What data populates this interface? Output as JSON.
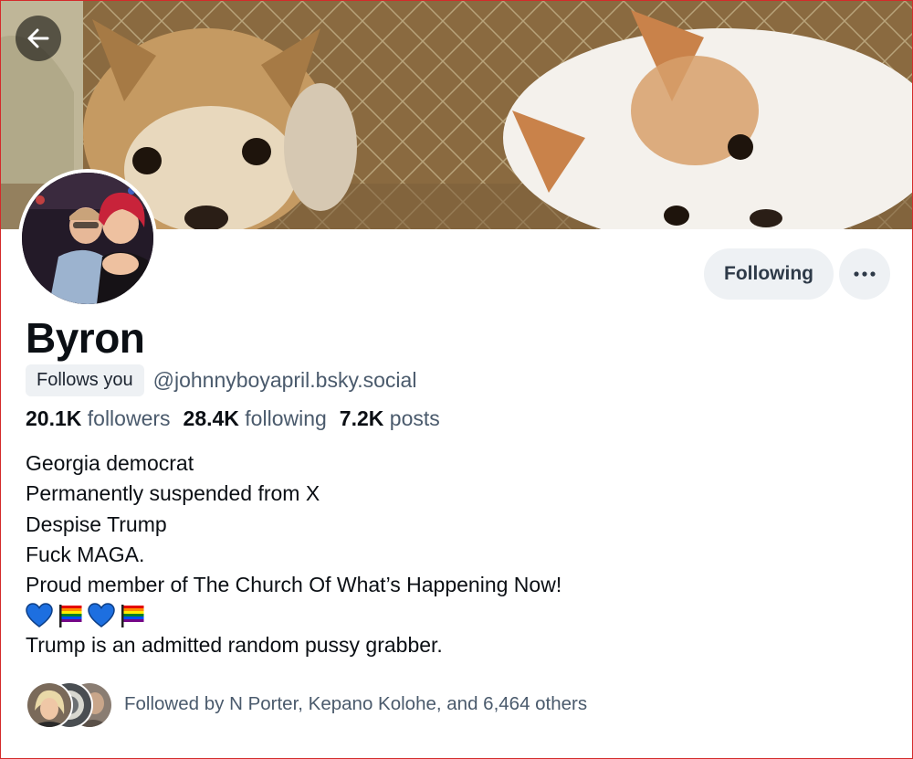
{
  "header": {
    "back_icon": "arrow-left-icon"
  },
  "profile": {
    "display_name": "Byron",
    "follows_you_badge": "Follows you",
    "handle": "@johnnyboyapril.bsky.social",
    "stats": {
      "followers_count": "20.1K",
      "followers_label": "followers",
      "following_count": "28.4K",
      "following_label": "following",
      "posts_count": "7.2K",
      "posts_label": "posts"
    },
    "bio_lines": [
      "Georgia democrat",
      "Permanently suspended from X",
      "Despise Trump",
      "Fuck MAGA.",
      "Proud member of The Church Of What’s Happening Now!",
      "Trump is an admitted random pussy grabber."
    ],
    "bio_emojis": [
      "blue-heart-icon",
      "rainbow-flag-icon",
      "blue-heart-icon",
      "rainbow-flag-icon"
    ],
    "followed_by_text": "Followed by N Porter, Kepano Kolohe, and 6,464 others"
  },
  "actions": {
    "following_label": "Following",
    "more_icon": "ellipsis-icon"
  },
  "colors": {
    "pill_bg": "#eef1f4",
    "muted_text": "#4a5a6c",
    "heart_blue": "#1d6fe0"
  }
}
